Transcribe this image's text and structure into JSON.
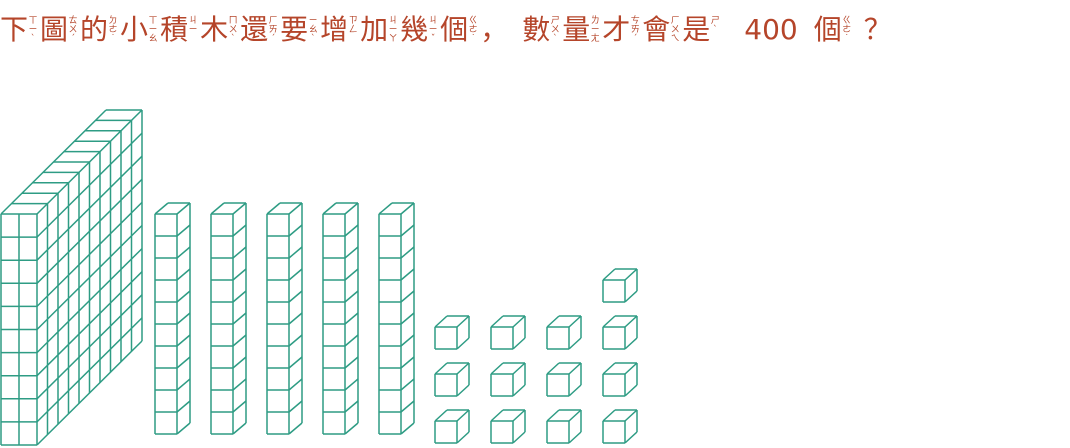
{
  "question": {
    "units": [
      {
        "char": "下",
        "zhuyin": "ㄒ\nㄧ\nˋ"
      },
      {
        "char": "圖",
        "zhuyin": "ㄊ\nㄨ\nˊ"
      },
      {
        "char": "的",
        "zhuyin": "ㄉ\nㄜ\n˙"
      },
      {
        "char": "小",
        "zhuyin": "ㄒ\nㄧ\nㄠ"
      },
      {
        "char": "積",
        "zhuyin": "ㄐ\nㄧ"
      },
      {
        "char": "木",
        "zhuyin": "ㄇ\nㄨ\nˋ"
      },
      {
        "char": "還",
        "zhuyin": "ㄏ\nㄞ\nˊ"
      },
      {
        "char": "要",
        "zhuyin": "ㄧ\nㄠ\nˋ"
      },
      {
        "char": "增",
        "zhuyin": "ㄗ\nㄥ"
      },
      {
        "char": "加",
        "zhuyin": "ㄐ\nㄧ\nㄚ"
      },
      {
        "char": "幾",
        "zhuyin": "ㄐ\nㄧ\nˇ"
      },
      {
        "char": "個",
        "zhuyin": "ㄍ\nㄜ\n˙"
      },
      {
        "char": "，",
        "zhuyin": ""
      },
      {
        "char": "數",
        "zhuyin": "ㄕ\nㄨ\nˋ"
      },
      {
        "char": "量",
        "zhuyin": "ㄌ\nㄧ\nㄤ"
      },
      {
        "char": "才",
        "zhuyin": "ㄘ\nㄞ\nˊ"
      },
      {
        "char": "會",
        "zhuyin": "ㄏ\nㄨ\nㄟ"
      },
      {
        "char": "是",
        "zhuyin": "ㄕ\nˋ"
      },
      {
        "char": "400",
        "zhuyin": ""
      },
      {
        "char": "個",
        "zhuyin": "ㄍ\nㄜ\n˙"
      },
      {
        "char": "？",
        "zhuyin": ""
      }
    ]
  },
  "blocks": {
    "flats": 1,
    "rods": 5,
    "unit_columns": [
      3,
      3,
      3,
      4
    ]
  },
  "colors": {
    "text": "#b5452a",
    "block_stroke": "#2e9c84"
  }
}
